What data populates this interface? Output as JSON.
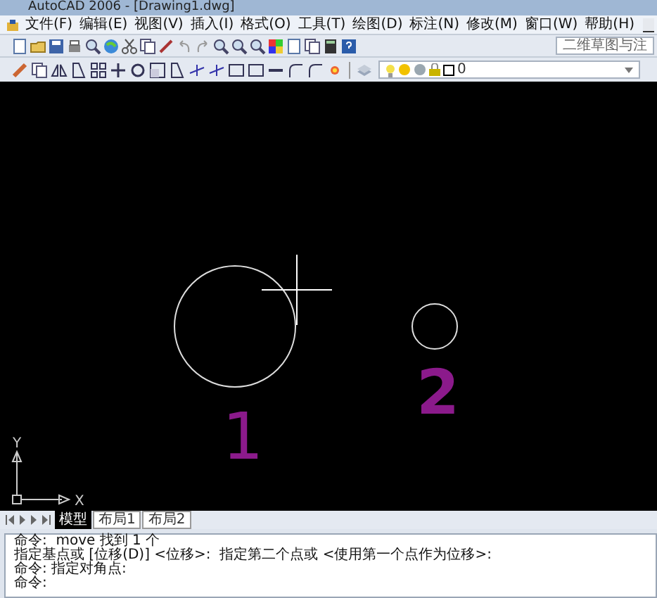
{
  "window": {
    "title": "AutoCAD 2006 - [Drawing1.dwg]"
  },
  "menu": [
    "文件(F)",
    "编辑(E)",
    "视图(V)",
    "插入(I)",
    "格式(O)",
    "工具(T)",
    "绘图(D)",
    "标注(N)",
    "修改(M)",
    "窗口(W)",
    "帮助(H)"
  ],
  "workspace": {
    "value": "二维草图与注"
  },
  "layer": {
    "value": "0"
  },
  "canvas": {
    "annotations": [
      {
        "text": "1",
        "color": "#8b1a8b"
      },
      {
        "text": "2",
        "color": "#8b1a8b"
      }
    ],
    "ucs": {
      "x_label": "X",
      "y_label": "Y"
    }
  },
  "tabs": [
    {
      "label": "模型",
      "selected": true
    },
    {
      "label": "布局1",
      "selected": false
    },
    {
      "label": "布局2",
      "selected": false
    }
  ],
  "command_lines": [
    "命令:  move 找到 1 个",
    "指定基点或 [位移(D)] <位移>:  指定第二个点或 <使用第一个点作为位移>:",
    "命令: 指定对角点:",
    "命令:"
  ]
}
